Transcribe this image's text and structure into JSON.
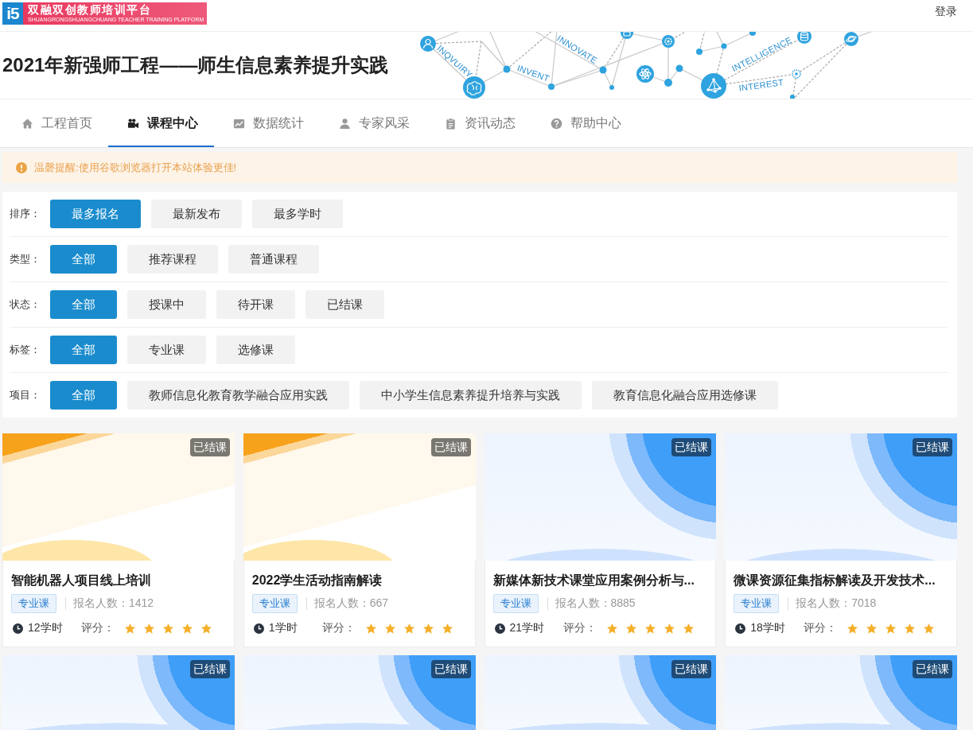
{
  "header": {
    "logo": {
      "mark": "i5",
      "title": "双融双创教师培训平台",
      "subtitle": "SHUANGRONGSHUANGCHUANG TEACHER TRAINING PLATFORM"
    },
    "login": "登录"
  },
  "banner": {
    "title": "2021年新强师工程——师生信息素养提升实践",
    "words": [
      "INQVUIRY",
      "INVENT",
      "INNOVATE",
      "INTELLIGENCE",
      "INTEREST"
    ]
  },
  "nav": {
    "tabs": [
      {
        "label": "工程首页",
        "selected": false
      },
      {
        "label": "课程中心",
        "selected": true
      },
      {
        "label": "数据统计",
        "selected": false
      },
      {
        "label": "专家风采",
        "selected": false
      },
      {
        "label": "资讯动态",
        "selected": false
      },
      {
        "label": "帮助中心",
        "selected": false
      }
    ]
  },
  "notice": {
    "text": "温磬提醒:使用谷歌浏览器打开本站体验更佳!"
  },
  "filters": [
    {
      "label": "排序：",
      "options": [
        {
          "label": "最多报名",
          "selected": true
        },
        {
          "label": "最新发布",
          "selected": false
        },
        {
          "label": "最多学时",
          "selected": false
        }
      ]
    },
    {
      "label": "类型：",
      "options": [
        {
          "label": "全部",
          "selected": true
        },
        {
          "label": "推荐课程",
          "selected": false
        },
        {
          "label": "普通课程",
          "selected": false
        }
      ]
    },
    {
      "label": "状态：",
      "options": [
        {
          "label": "全部",
          "selected": true
        },
        {
          "label": "授课中",
          "selected": false
        },
        {
          "label": "待开课",
          "selected": false
        },
        {
          "label": "已结课",
          "selected": false
        }
      ]
    },
    {
      "label": "标签：",
      "options": [
        {
          "label": "全部",
          "selected": true
        },
        {
          "label": "专业课",
          "selected": false
        },
        {
          "label": "选修课",
          "selected": false
        }
      ]
    },
    {
      "label": "项目：",
      "options": [
        {
          "label": "全部",
          "selected": true
        },
        {
          "label": "教师信息化教育教学融合应用实践",
          "selected": false
        },
        {
          "label": "中小学生信息素养提升培养与实践",
          "selected": false
        },
        {
          "label": "教育信息化融合应用选修课",
          "selected": false
        }
      ]
    }
  ],
  "courses": [
    {
      "kind": "orange",
      "status": "已结课",
      "title": "智能机器人项目线上培训",
      "tag": "专业课",
      "enrollment": "报名人数：1412",
      "hours": "12学时",
      "rating_label": "评分：",
      "stars": 5
    },
    {
      "kind": "orange",
      "status": "已结课",
      "title": "2022学生活动指南解读",
      "tag": "专业课",
      "enrollment": "报名人数：667",
      "hours": "1学时",
      "rating_label": "评分：",
      "stars": 5
    },
    {
      "kind": "blue",
      "status": "已结课",
      "title": "新媒体新技术课堂应用案例分析与...",
      "tag": "专业课",
      "enrollment": "报名人数：8885",
      "hours": "21学时",
      "rating_label": "评分：",
      "stars": 5
    },
    {
      "kind": "blue",
      "status": "已结课",
      "title": "微课资源征集指标解读及开发技术...",
      "tag": "专业课",
      "enrollment": "报名人数：7018",
      "hours": "18学时",
      "rating_label": "评分：",
      "stars": 5
    },
    {
      "kind": "blue",
      "status": "已结课"
    },
    {
      "kind": "blue",
      "status": "已结课"
    },
    {
      "kind": "blue",
      "status": "已结课"
    },
    {
      "kind": "blue",
      "status": "已结课"
    }
  ]
}
